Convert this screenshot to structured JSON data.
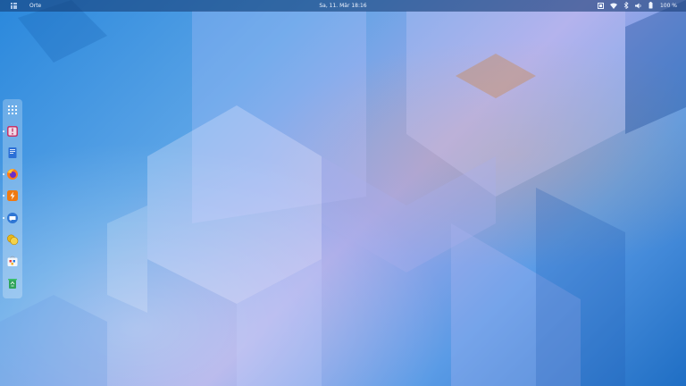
{
  "topbar": {
    "places_label": "Orte",
    "clock": "Sa, 11. Mär  18:16",
    "battery_percent": "100 %"
  },
  "tray_icons": [
    "screen-icon",
    "wifi-icon",
    "bluetooth-icon",
    "volume-icon",
    "battery-icon"
  ],
  "dock": {
    "items": [
      {
        "name": "app-grid",
        "running": false
      },
      {
        "name": "app-1",
        "running": true
      },
      {
        "name": "notes-app",
        "running": false
      },
      {
        "name": "firefox",
        "running": true
      },
      {
        "name": "app-orange",
        "running": true
      },
      {
        "name": "chat-app",
        "running": true
      },
      {
        "name": "coins-app",
        "running": false
      },
      {
        "name": "app-store",
        "running": false
      },
      {
        "name": "recycle-bin",
        "running": false
      }
    ]
  },
  "colors": {
    "topbar": "#12376e",
    "accent": "#2a88dc"
  }
}
